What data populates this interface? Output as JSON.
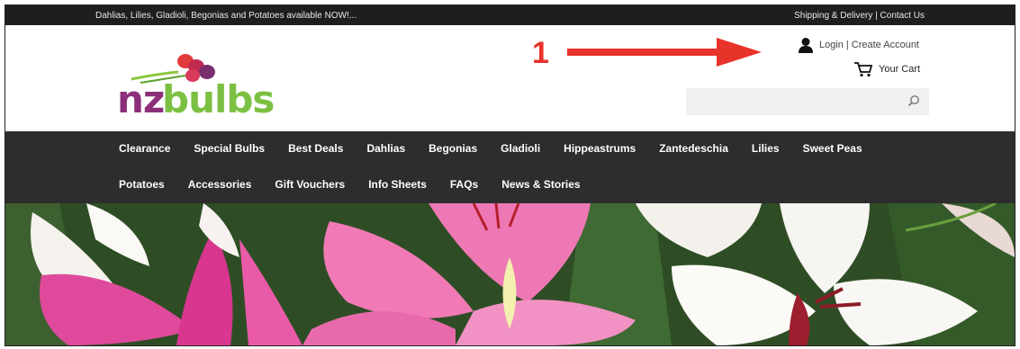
{
  "topbar": {
    "promo": "Dahlias, Lilies, Gladioli, Begonias and Potatoes available NOW!...",
    "shipping": "Shipping & Delivery",
    "separator": "|",
    "contact": "Contact Us"
  },
  "logo": {
    "part1": "nz",
    "part2": "bulbs"
  },
  "annotation": {
    "number": "1",
    "color": "#e8332b"
  },
  "account": {
    "icon": "user-icon",
    "login": "Login",
    "separator": "|",
    "create": "Create Account"
  },
  "cart": {
    "icon": "cart-icon",
    "label": "Your Cart"
  },
  "search": {
    "placeholder": "",
    "icon": "search-icon"
  },
  "nav": {
    "row1": [
      "Clearance",
      "Special Bulbs",
      "Best Deals",
      "Dahlias",
      "Begonias",
      "Gladioli",
      "Hippeastrums",
      "Zantedeschia",
      "Lilies",
      "Sweet Peas"
    ],
    "row2": [
      "Potatoes",
      "Accessories",
      "Gift Vouchers",
      "Info Sheets",
      "FAQs",
      "News & Stories"
    ]
  },
  "colors": {
    "brand_purple": "#8b2f7a",
    "brand_green": "#7cc043",
    "nav_bg": "#2d2d2d",
    "topbar_bg": "#1e1e1e"
  }
}
